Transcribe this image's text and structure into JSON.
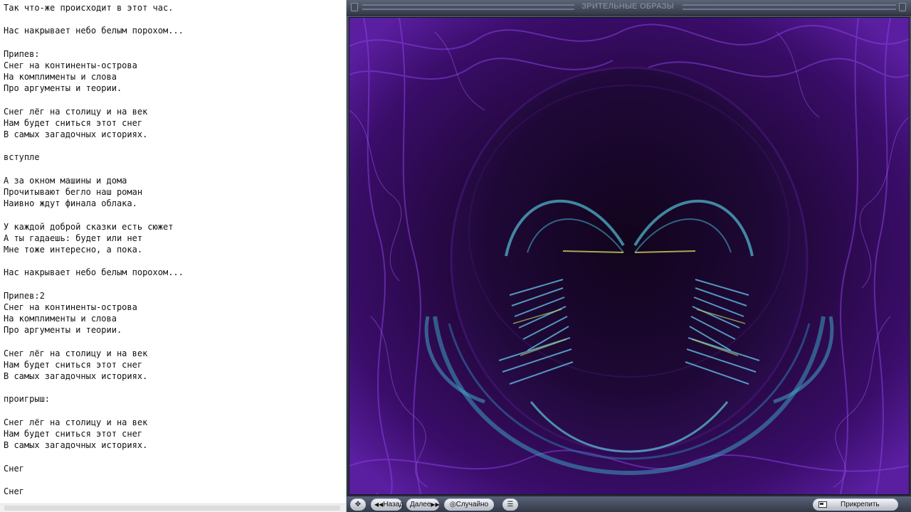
{
  "editor": {
    "lines": [
      "Так что-же происходит в этот час.",
      "",
      "Нас накрывает небо белым порохом...",
      "",
      "Припев:",
      "Снег на континенты-острова",
      "На комплименты и слова",
      "Про аргументы и теории.",
      "",
      "Снег лёг на столицу и на век",
      "Нам будет сниться этот снег",
      "В самых загадочных историях.",
      "",
      "вступле",
      "",
      "А за окном машины и дома",
      "Прочитывают бегло наш роман",
      "Наивно ждут финала облака.",
      "",
      "У каждой доброй сказки есть сюжет",
      "А ты гадаешь: будет или нет",
      "Мне тоже интересно, а пока.",
      "",
      "Нас накрывает небо белым порохом...",
      "",
      "Припев:2",
      "Снег на континенты-острова",
      "На комплименты и слова",
      "Про аргументы и теории.",
      "",
      "Снег лёг на столицу и на век",
      "Нам будет сниться этот снег",
      "В самых загадочных историях.",
      "",
      "проигрыш:",
      "",
      "Снег лёг на столицу и на век",
      "Нам будет сниться этот снег",
      "В самых загадочных историях.",
      "",
      "Снег",
      "",
      "Снег"
    ]
  },
  "player": {
    "title": "ЗРИТЕЛЬНЫЕ ОБРАЗЫ",
    "buttons": {
      "back_icon": "◀◀",
      "back_label": "Назад",
      "next_label": "Далее",
      "next_icon": "▶▶",
      "shuffle_icon": "◎",
      "shuffle_label": "Случайно",
      "dock_label": "Прикрепить"
    },
    "icons": {
      "fullscreen": "fullscreen-icon",
      "list": "list-icon",
      "dock": "dock-icon"
    },
    "colors": {
      "vis_background": "#1a0a2c",
      "vis_accent": "#7a2bd6",
      "vis_lines": "#4fb3c8"
    }
  }
}
